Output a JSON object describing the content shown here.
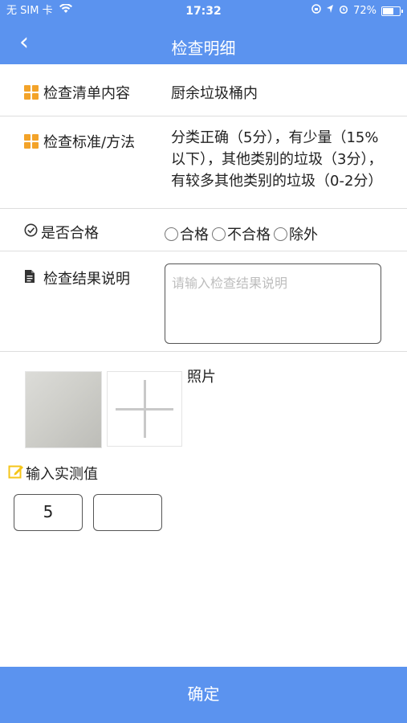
{
  "status_bar": {
    "carrier": "无 SIM 卡",
    "time": "17:32",
    "battery": "72%",
    "battery_level": 0.72
  },
  "nav": {
    "back_glyph": "‹",
    "title": "检查明细"
  },
  "checklist": {
    "label": "检查清单内容",
    "value": "厨余垃圾桶内"
  },
  "standard": {
    "label": "检查标准/方法",
    "value": "分类正确（5分），有少量（15%以下），其他类别的垃圾（3分），有较多其他类别的垃圾（0-2分）"
  },
  "qualified": {
    "label": "是否合格",
    "options": [
      "合格",
      "不合格",
      "除外"
    ]
  },
  "result": {
    "label": "检查结果说明",
    "placeholder": "请输入检查结果说明"
  },
  "photo": {
    "label": "照片"
  },
  "measure": {
    "label": "输入实测值",
    "values": [
      "5",
      ""
    ]
  },
  "confirm_label": "确定",
  "colors": {
    "accent": "#5b93ef",
    "icon_orange": "#f3a329",
    "edit_yellow": "#f5c518"
  }
}
